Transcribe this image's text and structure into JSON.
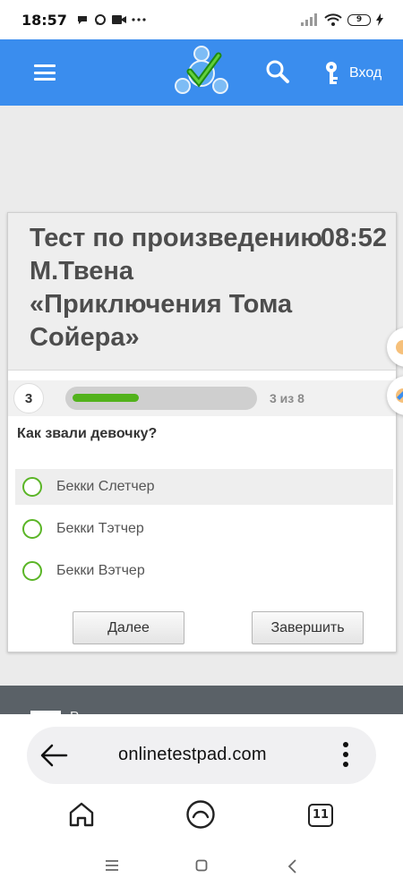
{
  "status_bar": {
    "time": "18:57",
    "battery": "9"
  },
  "header": {
    "login_label": "Вход"
  },
  "test": {
    "title": "Тест по произведению М.Твена «Приключения Тома Сойера»",
    "timer": "08:52",
    "question_number": "3",
    "progress_text": "3 из 8",
    "progress_fraction": 0.375,
    "question": "Как звали девочку?",
    "options": [
      "Бекки Слетчер",
      "Бекки Тэтчер",
      "Бекки Вэтчер"
    ],
    "next_label": "Далее",
    "finish_label": "Завершить"
  },
  "footer": {
    "partial_text": "Р..."
  },
  "browser": {
    "url": "onlinetestpad.com",
    "tab_count": "11"
  },
  "colors": {
    "header_blue": "#3a8dee",
    "progress_green": "#52b21c",
    "radio_green": "#5ab526"
  },
  "icons": [
    "menu-icon",
    "site-logo",
    "search-icon",
    "key-icon",
    "back-arrow-icon",
    "more-icon",
    "home-icon",
    "assistant-icon",
    "tabs-icon"
  ]
}
